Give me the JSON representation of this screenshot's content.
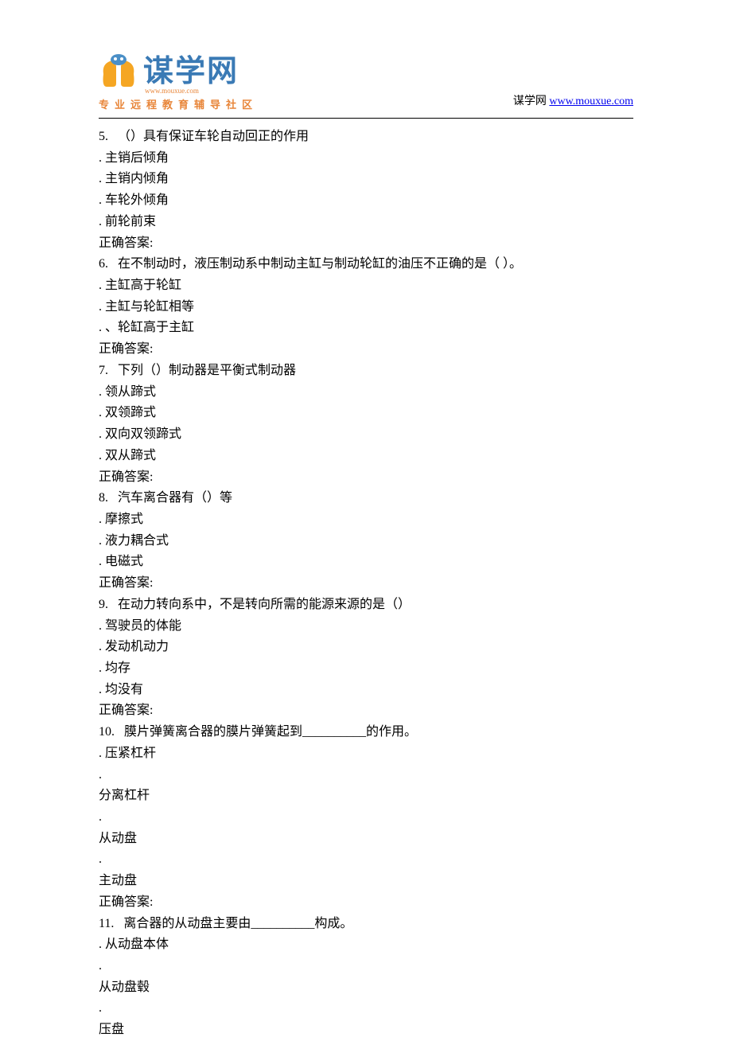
{
  "header": {
    "logo_main": "谋学网",
    "logo_url_small": "www.mouxue.com",
    "logo_tagline": "专业远程教育辅导社区",
    "site_label": "谋学网 ",
    "site_url": "www.mouxue.com"
  },
  "questions": [
    {
      "num": "5.",
      "text": "（）具有保证车轮自动回正的作用",
      "options": [
        "主销后倾角",
        "主销内倾角",
        "车轮外倾角",
        "前轮前束"
      ],
      "answer_label": "正确答案:"
    },
    {
      "num": "6.",
      "text": "在不制动时，液压制动系中制动主缸与制动轮缸的油压不正确的是（ ）。",
      "options": [
        "主缸高于轮缸",
        "主缸与轮缸相等",
        "、轮缸高于主缸"
      ],
      "answer_label": "正确答案:"
    },
    {
      "num": "7.",
      "text": "下列（）制动器是平衡式制动器",
      "options": [
        "领从蹄式",
        "双领蹄式",
        "双向双领蹄式",
        "双从蹄式"
      ],
      "answer_label": "正确答案:"
    },
    {
      "num": "8.",
      "text": "汽车离合器有（）等",
      "options": [
        "摩擦式",
        "液力耦合式",
        "电磁式"
      ],
      "answer_label": "正确答案:"
    },
    {
      "num": "9.",
      "text": "在动力转向系中，不是转向所需的能源来源的是（）",
      "options": [
        "驾驶员的体能",
        "发动机动力",
        "均存",
        "均没有"
      ],
      "answer_label": "正确答案:"
    },
    {
      "num": "10.",
      "text": "膜片弹簧离合器的膜片弹簧起到__________的作用。",
      "options_inline": [
        "压紧杠杆"
      ],
      "options_block": [
        "分离杠杆",
        "从动盘",
        "主动盘"
      ],
      "answer_label": "正确答案:"
    },
    {
      "num": "11.",
      "text": "离合器的从动盘主要由__________构成。",
      "options_inline": [
        "从动盘本体"
      ],
      "options_block": [
        "从动盘毂",
        "压盘"
      ],
      "answer_label": ""
    }
  ]
}
